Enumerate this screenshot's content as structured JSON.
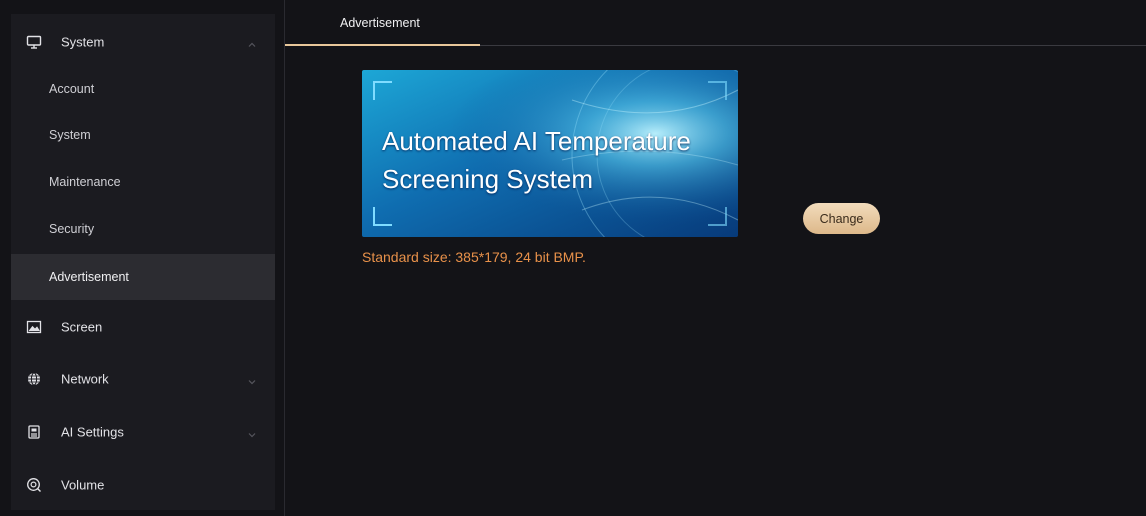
{
  "sidebar": {
    "groups": [
      {
        "label": "System",
        "icon": "monitor-icon",
        "expanded": true
      },
      {
        "label": "Screen",
        "icon": "picture-icon"
      },
      {
        "label": "Network",
        "icon": "globe-icon",
        "expanded": false
      },
      {
        "label": "AI Settings",
        "icon": "chip-icon",
        "expanded": false
      },
      {
        "label": "Volume",
        "icon": "speaker-icon"
      }
    ],
    "system_items": [
      {
        "label": "Account"
      },
      {
        "label": "System"
      },
      {
        "label": "Maintenance"
      },
      {
        "label": "Security"
      },
      {
        "label": "Advertisement",
        "active": true
      }
    ]
  },
  "tabs": [
    {
      "label": "Advertisement",
      "active": true
    }
  ],
  "advertisement": {
    "banner_lines": [
      "Automated AI Temperature",
      "Screening System"
    ],
    "hint": "Standard size: 385*179, 24 bit BMP.",
    "change_label": "Change"
  },
  "colors": {
    "accent": "#e8c79a",
    "hint": "#e8914a",
    "background": "#131317",
    "sidebar": "#1b1b20",
    "active_item": "#2c2c31"
  }
}
